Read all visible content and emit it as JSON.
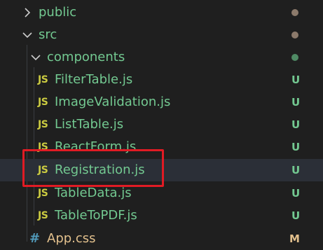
{
  "explorer": {
    "folders": {
      "public": {
        "label": "public",
        "dot_color": "#8c7a6b"
      },
      "src": {
        "label": "src",
        "dot_color": "#8c7a6b"
      },
      "components": {
        "label": "components",
        "dot_color": "#4f8a64"
      }
    },
    "files": [
      {
        "icon": "JS",
        "label": "FilterTable.js",
        "status": "U"
      },
      {
        "icon": "JS",
        "label": "ImageValidation.js",
        "status": "U"
      },
      {
        "icon": "JS",
        "label": "ListTable.js",
        "status": "U"
      },
      {
        "icon": "JS",
        "label": "ReactForm.js",
        "status": "U"
      },
      {
        "icon": "JS",
        "label": "Registration.js",
        "status": "U"
      },
      {
        "icon": "JS",
        "label": "TableData.js",
        "status": "U"
      },
      {
        "icon": "JS",
        "label": "TableToPDF.js",
        "status": "U"
      }
    ],
    "app_css": {
      "icon": "#",
      "label": "App.css",
      "status": "M"
    }
  },
  "colors": {
    "untracked": "#73c991",
    "modified": "#e2c08d",
    "js_icon": "#cbcb41",
    "css_icon": "#519aba",
    "annotation": "#e01b24"
  }
}
